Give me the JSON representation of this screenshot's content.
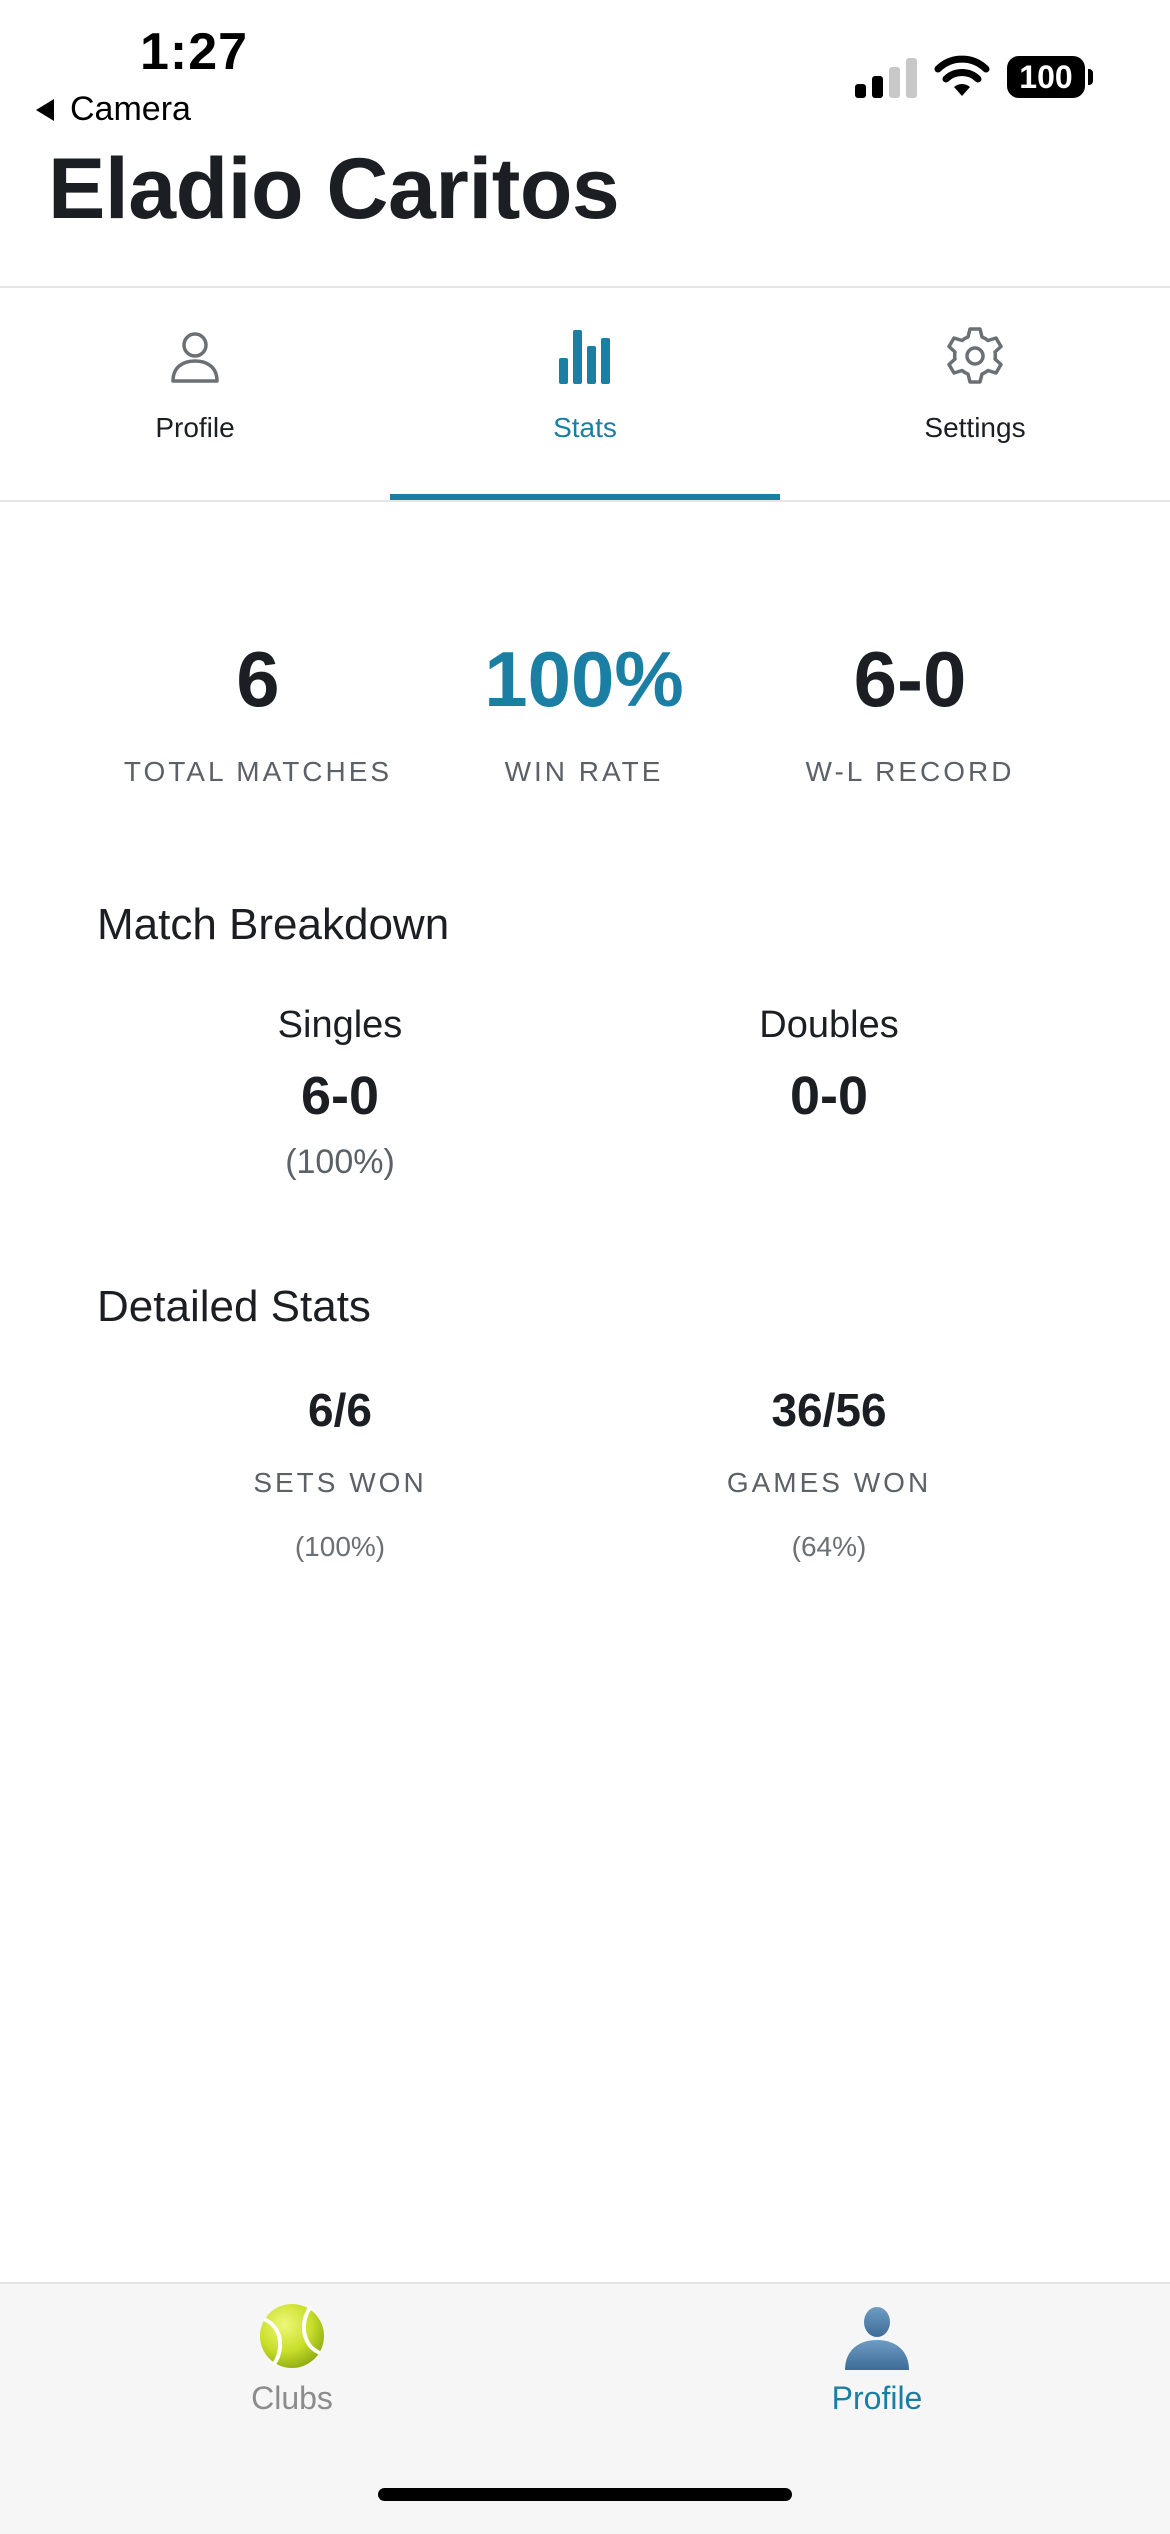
{
  "status_bar": {
    "time": "1:27",
    "back_label": "Camera",
    "battery": "100"
  },
  "header": {
    "title": "Eladio Caritos"
  },
  "tabs": [
    {
      "label": "Profile",
      "icon": "person-icon",
      "active": false
    },
    {
      "label": "Stats",
      "icon": "bar-chart-icon",
      "active": true
    },
    {
      "label": "Settings",
      "icon": "gear-icon",
      "active": false
    }
  ],
  "summary": {
    "total_matches": {
      "value": "6",
      "label": "TOTAL MATCHES"
    },
    "win_rate": {
      "value": "100%",
      "label": "WIN RATE"
    },
    "record": {
      "value": "6-0",
      "label": "W-L RECORD"
    }
  },
  "match_breakdown": {
    "title": "Match Breakdown",
    "singles": {
      "name": "Singles",
      "record": "6-0",
      "pct": "(100%)"
    },
    "doubles": {
      "name": "Doubles",
      "record": "0-0"
    }
  },
  "detailed_stats": {
    "title": "Detailed Stats",
    "sets": {
      "value": "6/6",
      "label": "SETS WON",
      "pct": "(100%)"
    },
    "games": {
      "value": "36/56",
      "label": "GAMES WON",
      "pct": "(64%)"
    }
  },
  "bottom_nav": [
    {
      "label": "Clubs",
      "icon": "tennis-ball-icon",
      "active": false
    },
    {
      "label": "Profile",
      "icon": "user-silhouette-icon",
      "active": true
    }
  ],
  "colors": {
    "accent": "#1a7fa3",
    "text": "#1b1f23",
    "muted": "#5b6167"
  }
}
